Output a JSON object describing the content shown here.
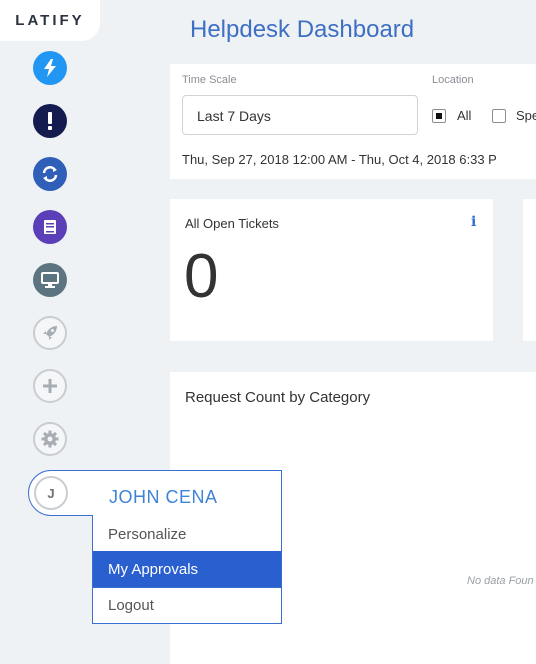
{
  "brand": {
    "logo_text": "LATIFY"
  },
  "sidebar": {
    "items": [
      {
        "name": "bolt",
        "color": "#2196f3"
      },
      {
        "name": "alert",
        "color": "#141c4f"
      },
      {
        "name": "sync",
        "color": "#2f5fb8"
      },
      {
        "name": "book",
        "color": "#5a3fb8"
      },
      {
        "name": "monitor",
        "color": "#5b7480"
      },
      {
        "name": "rocket"
      },
      {
        "name": "plus"
      },
      {
        "name": "gear"
      }
    ]
  },
  "header": {
    "title": "Helpdesk Dashboard"
  },
  "filters": {
    "time_scale_label": "Time Scale",
    "time_scale_value": "Last 7 Days",
    "location_label": "Location",
    "location_options": [
      "All",
      "Spe"
    ],
    "location_selected": "All",
    "date_range": "Thu, Sep 27, 2018 12:00 AM - Thu, Oct 4, 2018 6:33 P"
  },
  "cards": {
    "open_tickets": {
      "title": "All Open Tickets",
      "value": "0",
      "info": "i"
    }
  },
  "chart": {
    "title": "Request Count by Category",
    "no_data": "No data Foun"
  },
  "user": {
    "initial": "J",
    "name": "JOHN CENA",
    "menu": [
      "Personalize",
      "My Approvals",
      "Logout"
    ],
    "active_item": "My Approvals"
  },
  "colors": {
    "accent": "#3e6fc4",
    "active_menu": "#2a5fd0",
    "background": "#eef2f5"
  }
}
